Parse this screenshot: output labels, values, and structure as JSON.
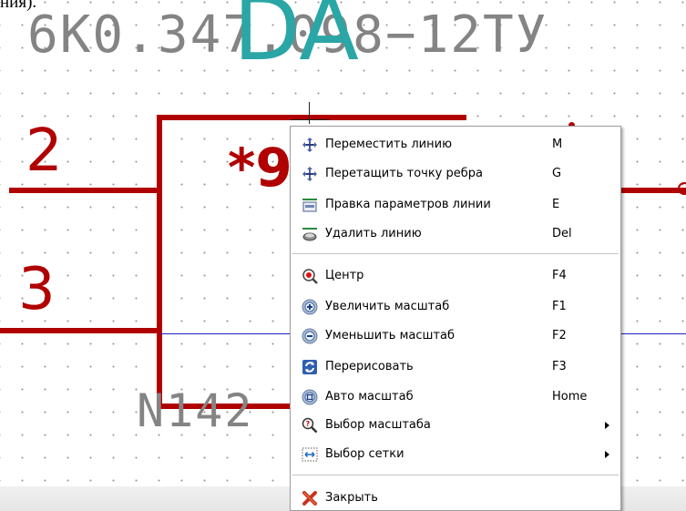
{
  "schematic": {
    "top_fragment": "ния).",
    "part_number": "6К0.347.098−12ТУ",
    "reference": "DA",
    "pin_left_top": "2",
    "pin_left_bottom": "3",
    "star_label": "*9",
    "value_label": "N142",
    "colors": {
      "wire": "#b00000",
      "reference": "#2aa6a6",
      "fields": "#848484",
      "bus": "#2020c0"
    }
  },
  "context_menu": {
    "items": [
      {
        "label": "Переместить линию",
        "shortcut": "M",
        "icon": "move-line-icon"
      },
      {
        "label": "Перетащить точку ребра",
        "shortcut": "G",
        "icon": "drag-edge-point-icon"
      },
      {
        "label": "Правка параметров линии",
        "shortcut": "E",
        "icon": "edit-line-params-icon"
      },
      {
        "label": "Удалить линию",
        "shortcut": "Del",
        "icon": "delete-line-icon"
      },
      {
        "label": "Центр",
        "shortcut": "F4",
        "icon": "center-icon"
      },
      {
        "label": "Увеличить масштаб",
        "shortcut": "F1",
        "icon": "zoom-in-icon"
      },
      {
        "label": "Уменьшить масштаб",
        "shortcut": "F2",
        "icon": "zoom-out-icon"
      },
      {
        "label": "Перерисовать",
        "shortcut": "F3",
        "icon": "redraw-icon"
      },
      {
        "label": "Авто масштаб",
        "shortcut": "Home",
        "icon": "auto-zoom-icon"
      },
      {
        "label": "Выбор масштаба",
        "shortcut": "",
        "icon": "select-zoom-icon",
        "submenu": true
      },
      {
        "label": "Выбор сетки",
        "shortcut": "",
        "icon": "select-grid-icon",
        "submenu": true
      },
      {
        "label": "Закрыть",
        "shortcut": "",
        "icon": "close-icon"
      }
    ]
  }
}
